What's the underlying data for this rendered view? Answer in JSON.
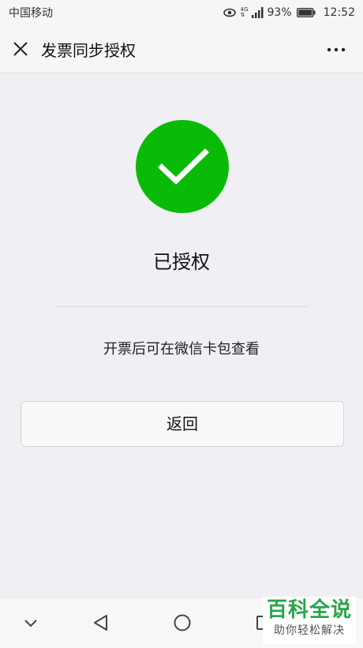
{
  "status_bar": {
    "carrier": "中国移动",
    "network": "4G",
    "battery": "93%",
    "time": "12:52"
  },
  "header": {
    "title": "发票同步授权",
    "close_icon": "close-icon",
    "more_icon": "more-icon"
  },
  "main": {
    "status_icon": "checkmark-icon",
    "title": "已授权",
    "description": "开票后可在微信卡包查看",
    "back_label": "返回"
  },
  "watermark": {
    "main": "百科全说",
    "sub": "助你轻松解决"
  },
  "colors": {
    "success": "#09bb07",
    "background": "#efeff4",
    "watermark_green": "#2aa44a"
  }
}
